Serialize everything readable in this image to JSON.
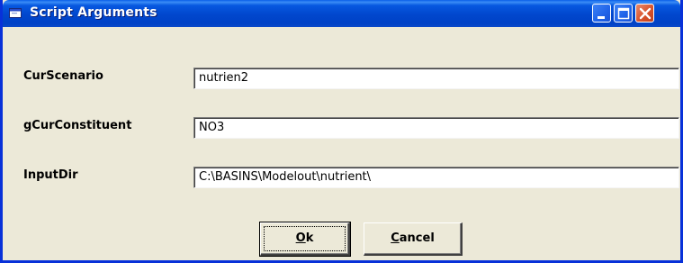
{
  "window": {
    "title": "Script Arguments",
    "titlebar_color": "#0147cd",
    "face_color": "#ece9d8"
  },
  "fields": [
    {
      "label": "CurScenario",
      "value": "nutrien2"
    },
    {
      "label": "gCurConstituent",
      "value": "NO3"
    },
    {
      "label": "InputDir",
      "value": "C:\\BASINS\\Modelout\\nutrient\\"
    }
  ],
  "buttons": {
    "ok": {
      "mnemonic": "O",
      "rest": "k"
    },
    "cancel": {
      "mnemonic": "C",
      "rest": "ancel"
    }
  },
  "titlebar_buttons": {
    "minimize": "minimize-icon",
    "maximize": "maximize-icon",
    "close": "close-icon"
  }
}
